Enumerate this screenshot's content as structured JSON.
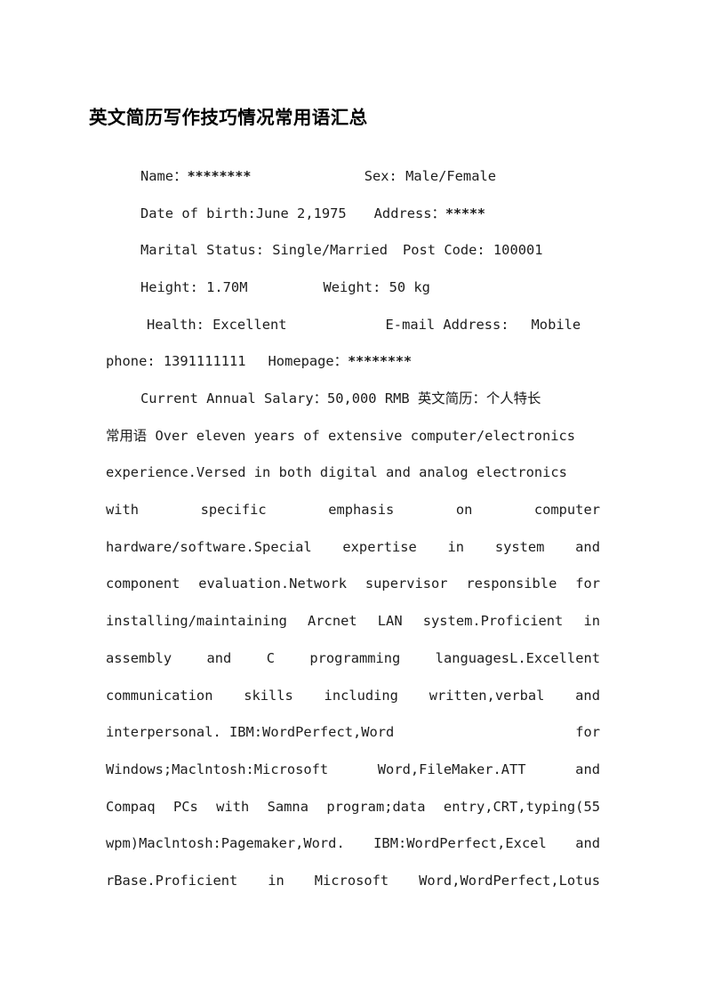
{
  "document": {
    "title": "英文简历写作技巧情况常用语汇总",
    "background_color": "#ffffff",
    "text_color": "#1d1d1d"
  },
  "resume_header": {
    "name_label": "Name：",
    "name_value": "********",
    "sex_label": "Sex: Male/Female",
    "dob_label": "Date of birth:June 2,1975",
    "address_label": "Address：",
    "address_value": "*****",
    "marital_status": "Marital Status: Single/Married",
    "post_code": "Post Code: 100001",
    "height": "Height: 1.70M",
    "weight": "Weight: 50 kg",
    "health": "Health: Excellent",
    "email_label": "E-mail Address:",
    "mobile_word": "Mobile",
    "phone_label": "phone: 1391111111",
    "homepage_label": "Homepage：",
    "homepage_value": "********"
  },
  "body_lines": [
    {
      "id": "line-salary",
      "mode": "flush",
      "indent": 39,
      "segments": [
        {
          "text": "Current Annual Salary：50,000 RMB ",
          "script": "latin"
        },
        {
          "text": "英文简历：个人特长",
          "script": "cjk"
        }
      ]
    },
    {
      "id": "line-over-eleven",
      "mode": "flush",
      "indent": 0,
      "segments": [
        {
          "text": "常用语",
          "script": "cjk"
        },
        {
          "text": " Over eleven years of extensive computer/electronics",
          "script": "latin"
        }
      ]
    },
    {
      "id": "line-experience",
      "mode": "flush",
      "indent": 0,
      "segments": [
        {
          "text": "experience.Versed in both digital and analog electronics",
          "script": "latin"
        }
      ]
    },
    {
      "id": "line-with-specific",
      "mode": "spread",
      "indent": 0,
      "segments": [
        {
          "text": "with",
          "script": "latin"
        },
        {
          "text": "specific",
          "script": "latin"
        },
        {
          "text": "emphasis",
          "script": "latin"
        },
        {
          "text": "on",
          "script": "latin"
        },
        {
          "text": "computer",
          "script": "latin"
        }
      ]
    },
    {
      "id": "line-hardware",
      "mode": "spread",
      "indent": 0,
      "segments": [
        {
          "text": "hardware/software.Special",
          "script": "latin"
        },
        {
          "text": "expertise",
          "script": "latin"
        },
        {
          "text": "in",
          "script": "latin"
        },
        {
          "text": "system",
          "script": "latin"
        },
        {
          "text": "and",
          "script": "latin"
        }
      ]
    },
    {
      "id": "line-component",
      "mode": "spread",
      "indent": 0,
      "segments": [
        {
          "text": "component",
          "script": "latin"
        },
        {
          "text": "evaluation.Network",
          "script": "latin"
        },
        {
          "text": "supervisor",
          "script": "latin"
        },
        {
          "text": "responsible",
          "script": "latin"
        },
        {
          "text": "for",
          "script": "latin"
        }
      ]
    },
    {
      "id": "line-installing",
      "mode": "spread",
      "indent": 0,
      "segments": [
        {
          "text": "installing/maintaining",
          "script": "latin"
        },
        {
          "text": "Arcnet",
          "script": "latin"
        },
        {
          "text": "LAN",
          "script": "latin"
        },
        {
          "text": "system.Proficient",
          "script": "latin"
        },
        {
          "text": "in",
          "script": "latin"
        }
      ]
    },
    {
      "id": "line-assembly",
      "mode": "spread",
      "indent": 0,
      "segments": [
        {
          "text": "assembly",
          "script": "latin"
        },
        {
          "text": "and",
          "script": "latin"
        },
        {
          "text": "C",
          "script": "latin"
        },
        {
          "text": "programming",
          "script": "latin"
        },
        {
          "text": "languagesL.Excellent",
          "script": "latin"
        }
      ]
    },
    {
      "id": "line-communication",
      "mode": "spread",
      "indent": 0,
      "segments": [
        {
          "text": "communication",
          "script": "latin"
        },
        {
          "text": "skills",
          "script": "latin"
        },
        {
          "text": "including",
          "script": "latin"
        },
        {
          "text": "written,verbal",
          "script": "latin"
        },
        {
          "text": "and",
          "script": "latin"
        }
      ]
    },
    {
      "id": "line-interpersonal",
      "mode": "spread",
      "indent": 0,
      "segments": [
        {
          "text": "interpersonal. IBM:WordPerfect,Word",
          "script": "latin"
        },
        {
          "text": "for",
          "script": "latin"
        }
      ]
    },
    {
      "id": "line-windows",
      "mode": "spread",
      "indent": 0,
      "segments": [
        {
          "text": "Windows;Maclntosh:Microsoft",
          "script": "latin"
        },
        {
          "text": "Word,FileMaker.ATT",
          "script": "latin"
        },
        {
          "text": "and",
          "script": "latin"
        }
      ]
    },
    {
      "id": "line-compaq",
      "mode": "spread",
      "indent": 0,
      "segments": [
        {
          "text": "Compaq",
          "script": "latin"
        },
        {
          "text": "PCs",
          "script": "latin"
        },
        {
          "text": "with",
          "script": "latin"
        },
        {
          "text": "Samna",
          "script": "latin"
        },
        {
          "text": "program;data",
          "script": "latin"
        },
        {
          "text": "entry,CRT,typing(55",
          "script": "latin"
        }
      ]
    },
    {
      "id": "line-wpm",
      "mode": "spread",
      "indent": 0,
      "segments": [
        {
          "text": "wpm)Maclntosh:Pagemaker,Word.",
          "script": "latin"
        },
        {
          "text": "IBM:WordPerfect,Excel",
          "script": "latin"
        },
        {
          "text": "and",
          "script": "latin"
        }
      ]
    },
    {
      "id": "line-rbase",
      "mode": "spread",
      "indent": 0,
      "segments": [
        {
          "text": "rBase.Proficient",
          "script": "latin"
        },
        {
          "text": "in",
          "script": "latin"
        },
        {
          "text": "Microsoft",
          "script": "latin"
        },
        {
          "text": "Word,WordPerfect,Lotus",
          "script": "latin"
        }
      ]
    }
  ]
}
